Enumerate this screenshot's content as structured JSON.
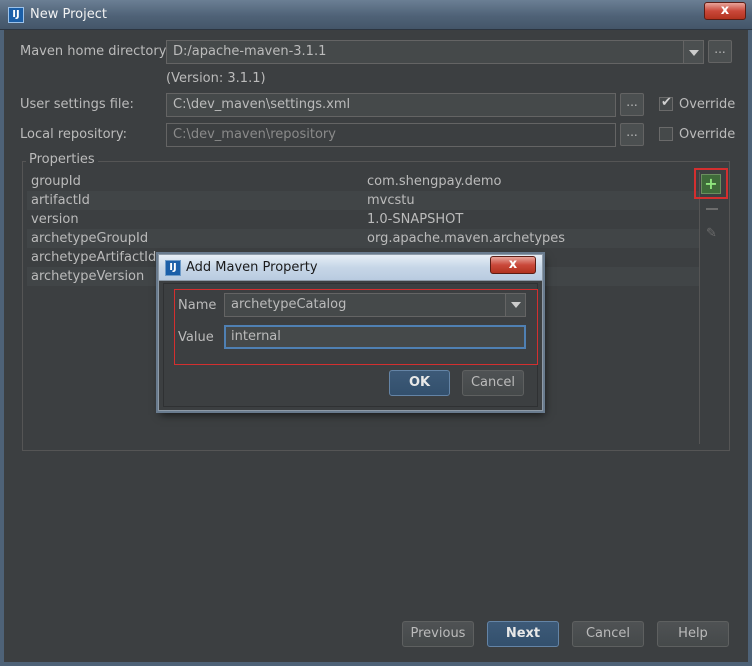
{
  "window": {
    "title": "New Project",
    "app_icon_text": "IJ",
    "close_symbol": "x"
  },
  "form": {
    "maven_home_label": "Maven home directory:",
    "maven_home_value": "D:/apache-maven-3.1.1",
    "version_text": "(Version: 3.1.1)",
    "user_settings_label": "User settings file:",
    "user_settings_value": "C:\\dev_maven\\settings.xml",
    "local_repo_label": "Local repository:",
    "local_repo_value": "C:\\dev_maven\\repository",
    "browse_label": "...",
    "override_label": "Override",
    "user_settings_override_checked": true,
    "local_repo_override_checked": false
  },
  "properties": {
    "title": "Properties",
    "rows": [
      {
        "key": "groupId",
        "value": "com.shengpay.demo"
      },
      {
        "key": "artifactId",
        "value": "mvcstu"
      },
      {
        "key": "version",
        "value": "1.0-SNAPSHOT"
      },
      {
        "key": "archetypeGroupId",
        "value": "org.apache.maven.archetypes"
      },
      {
        "key": "archetypeArtifactId",
        "value": ""
      },
      {
        "key": "archetypeVersion",
        "value": ""
      }
    ],
    "add_symbol": "+",
    "edit_symbol": "✎"
  },
  "dialog": {
    "title": "Add Maven Property",
    "app_icon_text": "IJ",
    "close_symbol": "x",
    "name_label": "Name",
    "name_value": "archetypeCatalog",
    "value_label": "Value",
    "value_value": "internal",
    "ok_label": "OK",
    "cancel_label": "Cancel"
  },
  "footer": {
    "previous_label": "Previous",
    "next_label": "Next",
    "cancel_label": "Cancel",
    "help_label": "Help"
  },
  "colors": {
    "background": "#3c3f41",
    "highlight_red": "#d32f2f",
    "focus_blue": "#4f80b3"
  }
}
